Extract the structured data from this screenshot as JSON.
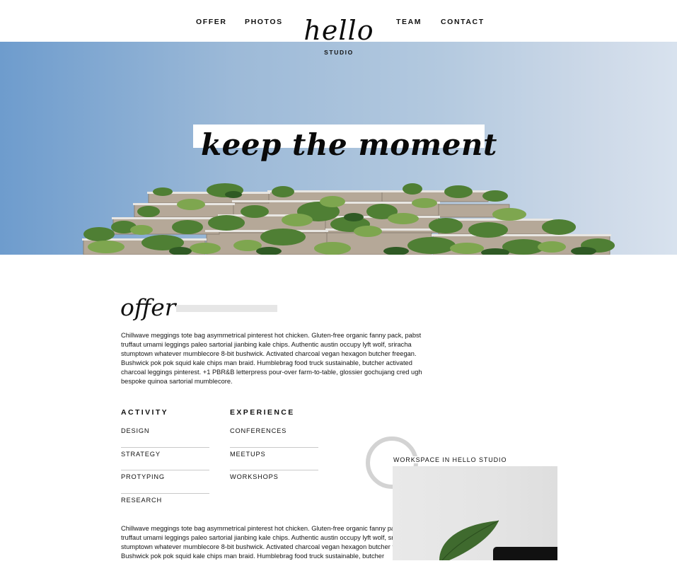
{
  "nav": {
    "items": [
      {
        "label": "OFFER"
      },
      {
        "label": "PHOTOS"
      },
      {
        "label": "TEAM"
      },
      {
        "label": "CONTACT"
      }
    ]
  },
  "logo": {
    "main": "hello",
    "sub": "STUDIO"
  },
  "hero": {
    "tagline": "keep the moment",
    "sky_colors": [
      "#6e9ccd",
      "#d8e2ee"
    ]
  },
  "offer": {
    "title": "offer",
    "paragraph": "Chillwave meggings tote bag asymmetrical pinterest hot chicken. Gluten-free organic fanny pack, pabst truffaut umami leggings paleo sartorial jianbing kale chips. Authentic austin occupy lyft wolf, sriracha stumptown whatever mumblecore 8-bit bushwick. Activated charcoal vegan hexagon butcher freegan. Bushwick pok pok squid kale chips man braid. Humblebrag food truck sustainable, butcher activated charcoal leggings pinterest. +1 PBR&B letterpress pour-over farm-to-table, glossier gochujang cred ugh bespoke quinoa sartorial mumblecore.",
    "paragraph_2": "Chillwave meggings tote bag asymmetrical pinterest hot chicken. Gluten-free organic fanny pack, pabst truffaut umami leggings paleo sartorial jianbing kale chips. Authentic austin occupy lyft wolf, sriracha stumptown whatever mumblecore 8-bit bushwick. Activated charcoal vegan hexagon butcher freegan. Bushwick pok pok squid kale chips man braid. Humblebrag food truck sustainable, butcher",
    "activity": {
      "heading": "ACTIVITY",
      "items": [
        "DESIGN",
        "STRATEGY",
        "PROTYPING",
        "RESEARCH"
      ]
    },
    "experience": {
      "heading": "EXPERIENCE",
      "items": [
        "CONFERENCES",
        "MEETUPS",
        "WORKSHOPS"
      ]
    }
  },
  "workspace": {
    "label": "WORKSPACE IN HELLO STUDIO"
  }
}
